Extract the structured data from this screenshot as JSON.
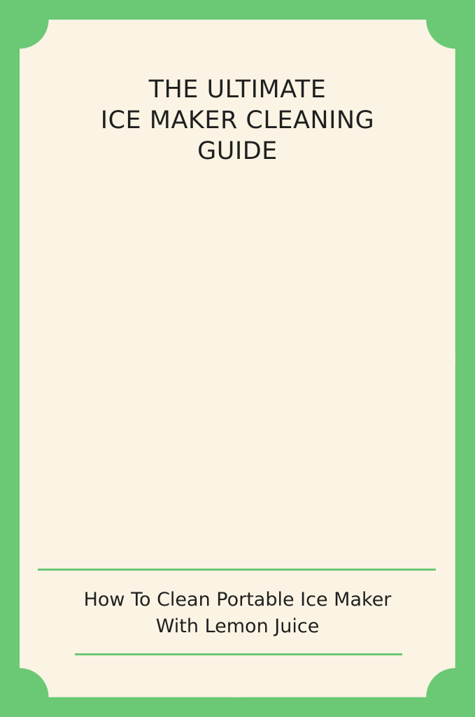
{
  "title_lines": [
    "THE ULTIMATE",
    "ICE MAKER CLEANING",
    "GUIDE"
  ],
  "subtitle_lines": [
    "How To Clean Portable Ice Maker",
    "With Lemon Juice"
  ],
  "colors": {
    "border_green": "#6bc875",
    "card_background": "#fbf4e4",
    "text": "#1f1f1f"
  }
}
